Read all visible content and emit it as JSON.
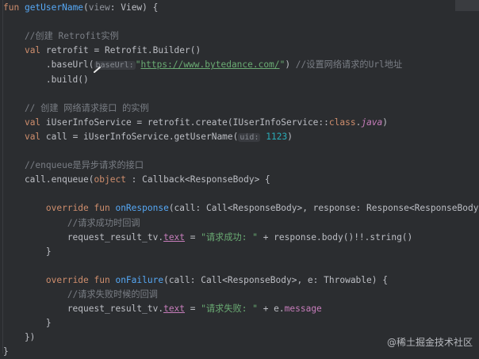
{
  "lines": [
    {
      "y": 0,
      "segments": [
        {
          "t": "fun ",
          "c": "kw"
        },
        {
          "t": "getUserName",
          "c": "fn"
        },
        {
          "t": "(",
          "c": ""
        },
        {
          "t": "view",
          "c": "param"
        },
        {
          "t": ": View) {",
          "c": ""
        }
      ]
    },
    {
      "y": 1,
      "segments": []
    },
    {
      "y": 2,
      "segments": [
        {
          "t": "    //创建 Retrofit实例",
          "c": "cm"
        }
      ]
    },
    {
      "y": 3,
      "segments": [
        {
          "t": "    ",
          "c": ""
        },
        {
          "t": "val ",
          "c": "kw"
        },
        {
          "t": "retrofit = Retrofit.Builder()",
          "c": ""
        }
      ]
    },
    {
      "y": 4,
      "segments": [
        {
          "t": "        .baseUrl(",
          "c": ""
        },
        {
          "t": "baseUrl:",
          "c": "hint"
        },
        {
          "t": "\"",
          "c": "str"
        },
        {
          "t": "https://www.bytedance.com/",
          "c": "str url"
        },
        {
          "t": "\"",
          "c": "str"
        },
        {
          "t": ") ",
          "c": ""
        },
        {
          "t": "//设置网络请求的Url地址",
          "c": "cm"
        }
      ]
    },
    {
      "y": 5,
      "segments": [
        {
          "t": "        .build()",
          "c": ""
        }
      ]
    },
    {
      "y": 6,
      "segments": []
    },
    {
      "y": 7,
      "segments": [
        {
          "t": "    // 创建 网络请求接口 的实例",
          "c": "cm"
        }
      ]
    },
    {
      "y": 8,
      "segments": [
        {
          "t": "    ",
          "c": ""
        },
        {
          "t": "val ",
          "c": "kw"
        },
        {
          "t": "iUserInfoService = retrofit.create(IUserInfoService::",
          "c": ""
        },
        {
          "t": "class",
          "c": "kw"
        },
        {
          "t": ".",
          "c": ""
        },
        {
          "t": "java",
          "c": "prop ital"
        },
        {
          "t": ")",
          "c": ""
        }
      ]
    },
    {
      "y": 9,
      "segments": [
        {
          "t": "    ",
          "c": ""
        },
        {
          "t": "val ",
          "c": "kw"
        },
        {
          "t": "call = iUserInfoService.getUserName(",
          "c": ""
        },
        {
          "t": "uid:",
          "c": "hint"
        },
        {
          "t": " ",
          "c": ""
        },
        {
          "t": "1123",
          "c": "num"
        },
        {
          "t": ")",
          "c": ""
        }
      ]
    },
    {
      "y": 10,
      "segments": []
    },
    {
      "y": 11,
      "segments": [
        {
          "t": "    //enqueue是异步请求的接口",
          "c": "cm"
        }
      ]
    },
    {
      "y": 12,
      "segments": [
        {
          "t": "    call.enqueue(",
          "c": ""
        },
        {
          "t": "object",
          "c": "kw"
        },
        {
          "t": " : Callback<ResponseBody> {",
          "c": ""
        }
      ]
    },
    {
      "y": 13,
      "segments": []
    },
    {
      "y": 14,
      "segments": [
        {
          "t": "        ",
          "c": ""
        },
        {
          "t": "override fun ",
          "c": "kw"
        },
        {
          "t": "onResponse",
          "c": "fn"
        },
        {
          "t": "(call: Call<ResponseBody>, response: Response<ResponseBody>) {",
          "c": ""
        }
      ]
    },
    {
      "y": 15,
      "segments": [
        {
          "t": "            //请求成功时回调",
          "c": "cm"
        }
      ]
    },
    {
      "y": 16,
      "segments": [
        {
          "t": "            request_result_tv.",
          "c": ""
        },
        {
          "t": "text",
          "c": "prop url"
        },
        {
          "t": " = ",
          "c": ""
        },
        {
          "t": "\"请求成功: \"",
          "c": "str"
        },
        {
          "t": " + response.body()!!.string()",
          "c": ""
        }
      ]
    },
    {
      "y": 17,
      "segments": [
        {
          "t": "        }",
          "c": ""
        }
      ]
    },
    {
      "y": 18,
      "segments": []
    },
    {
      "y": 19,
      "segments": [
        {
          "t": "        ",
          "c": ""
        },
        {
          "t": "override fun ",
          "c": "kw"
        },
        {
          "t": "onFailure",
          "c": "fn"
        },
        {
          "t": "(call: Call<ResponseBody>, e: Throwable) {",
          "c": ""
        }
      ]
    },
    {
      "y": 20,
      "segments": [
        {
          "t": "            //请求失败时候的回调",
          "c": "cm"
        }
      ]
    },
    {
      "y": 21,
      "segments": [
        {
          "t": "            request_result_tv.",
          "c": ""
        },
        {
          "t": "text",
          "c": "prop url"
        },
        {
          "t": " = ",
          "c": ""
        },
        {
          "t": "\"请求失败: \"",
          "c": "str"
        },
        {
          "t": " + e.",
          "c": ""
        },
        {
          "t": "message",
          "c": "prop"
        }
      ]
    },
    {
      "y": 22,
      "segments": [
        {
          "t": "        }",
          "c": ""
        }
      ]
    },
    {
      "y": 23,
      "segments": [
        {
          "t": "    })",
          "c": ""
        }
      ]
    },
    {
      "y": 24,
      "segments": [
        {
          "t": "}",
          "c": ""
        }
      ]
    }
  ],
  "watermark": "@稀土掘金技术社区",
  "colors": {
    "background": "#2b2d30",
    "keyword": "#cf8e6d",
    "function": "#56a8f5",
    "string": "#6aab73",
    "number": "#2aacb8",
    "comment": "#7a7e85",
    "property": "#c77dbb"
  }
}
